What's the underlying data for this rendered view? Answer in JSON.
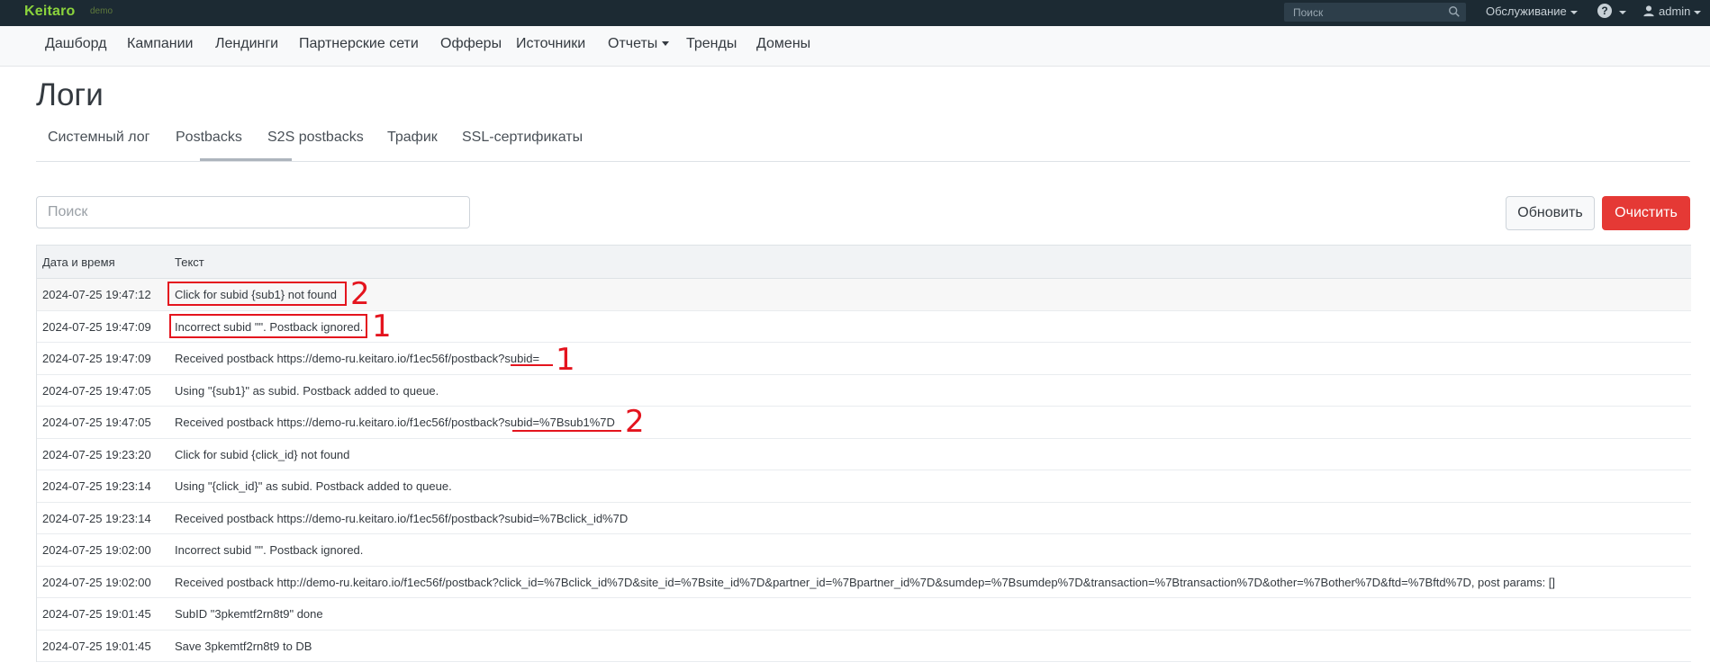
{
  "topbar": {
    "logo": "Keitaro",
    "logo_tag": "demo",
    "search_placeholder": "Поиск",
    "service_label": "Обслуживание",
    "help_symbol": "?",
    "user_label": "admin"
  },
  "nav": {
    "items": [
      {
        "label": "Дашборд"
      },
      {
        "label": "Кампании"
      },
      {
        "label": "Лендинги"
      },
      {
        "label": "Партнерские сети"
      },
      {
        "label": "Офферы"
      },
      {
        "label": "Источники"
      },
      {
        "label": "Отчеты"
      },
      {
        "label": "Тренды"
      },
      {
        "label": "Домены"
      }
    ]
  },
  "page": {
    "title": "Логи"
  },
  "tabs": [
    {
      "label": "Системный лог",
      "active": false
    },
    {
      "label": "Postbacks",
      "active": true
    },
    {
      "label": "S2S postbacks",
      "active": false
    },
    {
      "label": "Трафик",
      "active": false
    },
    {
      "label": "SSL-сертификаты",
      "active": false
    }
  ],
  "toolbar": {
    "search_placeholder": "Поиск",
    "refresh_label": "Обновить",
    "clear_label": "Очистить"
  },
  "table": {
    "headers": {
      "date": "Дата и время",
      "text": "Текст"
    },
    "rows": [
      {
        "date": "2024-07-25 19:47:12",
        "text": "Click for subid {sub1} not found"
      },
      {
        "date": "2024-07-25 19:47:09",
        "text": "Incorrect subid \"\". Postback ignored."
      },
      {
        "date": "2024-07-25 19:47:09",
        "text": "Received postback https://demo-ru.keitaro.io/f1ec56f/postback?subid="
      },
      {
        "date": "2024-07-25 19:47:05",
        "text": "Using \"{sub1}\" as subid. Postback added to queue."
      },
      {
        "date": "2024-07-25 19:47:05",
        "text": "Received postback https://demo-ru.keitaro.io/f1ec56f/postback?subid=%7Bsub1%7D"
      },
      {
        "date": "2024-07-25 19:23:20",
        "text": "Click for subid {click_id} not found"
      },
      {
        "date": "2024-07-25 19:23:14",
        "text": "Using \"{click_id}\" as subid. Postback added to queue."
      },
      {
        "date": "2024-07-25 19:23:14",
        "text": "Received postback https://demo-ru.keitaro.io/f1ec56f/postback?subid=%7Bclick_id%7D"
      },
      {
        "date": "2024-07-25 19:02:00",
        "text": "Incorrect subid \"\". Postback ignored."
      },
      {
        "date": "2024-07-25 19:02:00",
        "text": "Received postback http://demo-ru.keitaro.io/f1ec56f/postback?click_id=%7Bclick_id%7D&site_id=%7Bsite_id%7D&partner_id=%7Bpartner_id%7D&sumdep=%7Bsumdep%7D&transaction=%7Btransaction%7D&other=%7Bother%7D&ftd=%7Bftd%7D, post params: []"
      },
      {
        "date": "2024-07-25 19:01:45",
        "text": "SubID \"3pkemtf2rn8t9\" done"
      },
      {
        "date": "2024-07-25 19:01:45",
        "text": "Save 3pkemtf2rn8t9 to DB"
      }
    ]
  },
  "annotations": {
    "num_1": "1",
    "num_2": "2",
    "color": "#e4141e"
  }
}
